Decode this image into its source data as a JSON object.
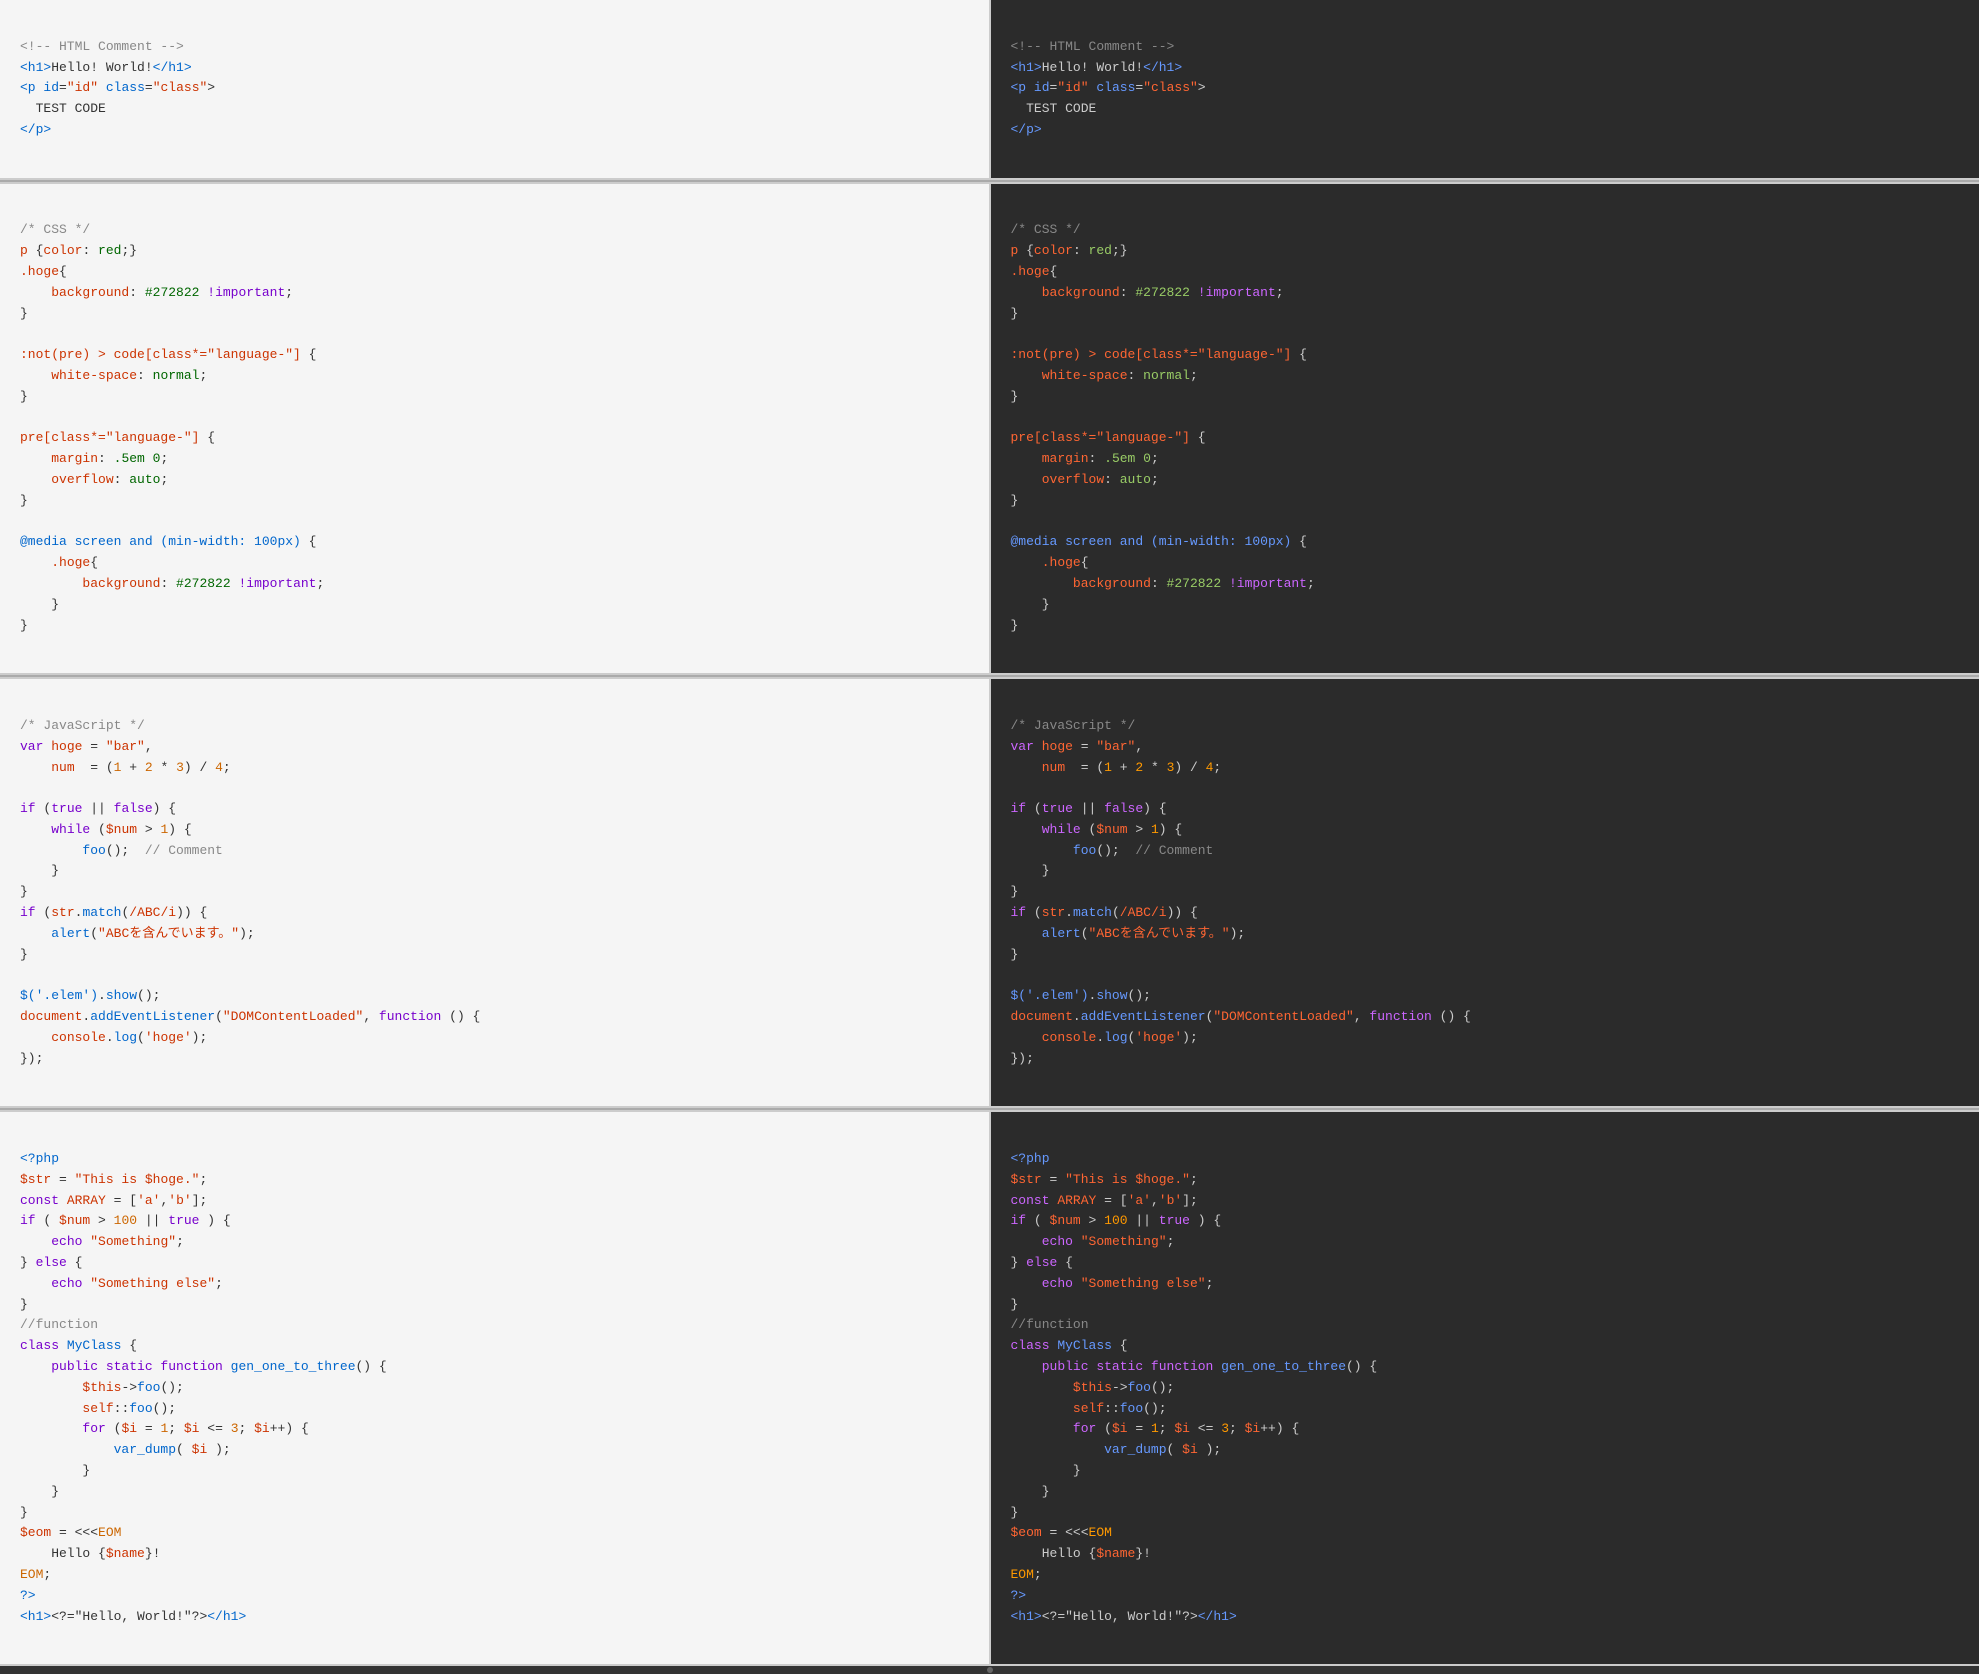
{
  "sections": [
    {
      "id": "html",
      "light_code": [
        {
          "type": "comment",
          "text": "<!-- HTML Comment -->"
        },
        {
          "type": "line",
          "parts": [
            {
              "cls": "c-tag",
              "text": "<h1>"
            },
            {
              "cls": "",
              "text": "Hello! World!"
            },
            {
              "cls": "c-tag",
              "text": "</h1>"
            }
          ]
        },
        {
          "type": "line",
          "parts": [
            {
              "cls": "c-tag",
              "text": "<p "
            },
            {
              "cls": "c-attr",
              "text": "id"
            },
            {
              "cls": "",
              "text": "=\"id\" "
            },
            {
              "cls": "c-attr",
              "text": "class"
            },
            {
              "cls": "",
              "text": "=\"class\">"
            }
          ]
        },
        {
          "type": "line",
          "parts": [
            {
              "cls": "",
              "text": "  TEST CODE"
            }
          ]
        },
        {
          "type": "line",
          "parts": [
            {
              "cls": "c-tag",
              "text": "</p>"
            }
          ]
        }
      ],
      "dark_code": [
        {
          "type": "comment",
          "text": "<!-- HTML Comment -->"
        },
        {
          "type": "line",
          "parts": [
            {
              "cls": "c-tag",
              "text": "<h1>"
            },
            {
              "cls": "",
              "text": "Hello! World!"
            },
            {
              "cls": "c-tag",
              "text": "</h1>"
            }
          ]
        },
        {
          "type": "line",
          "parts": [
            {
              "cls": "c-tag",
              "text": "<p "
            },
            {
              "cls": "c-attr",
              "text": "id"
            },
            {
              "cls": "",
              "text": "=\"id\" "
            },
            {
              "cls": "c-attr",
              "text": "class"
            },
            {
              "cls": "",
              "text": "=\"class\">"
            }
          ]
        },
        {
          "type": "line",
          "parts": [
            {
              "cls": "",
              "text": "  TEST CODE"
            }
          ]
        },
        {
          "type": "line",
          "parts": [
            {
              "cls": "c-tag",
              "text": "</"
            },
            {
              "cls": "c-tag",
              "text": "p"
            },
            {
              "cls": "c-tag",
              "text": ">"
            }
          ]
        }
      ]
    }
  ],
  "labels": {
    "html_comment": "<!-- HTML Comment -->",
    "css_comment": "/* CSS */",
    "js_comment": "/* JavaScript */",
    "php_open": "<?php"
  }
}
